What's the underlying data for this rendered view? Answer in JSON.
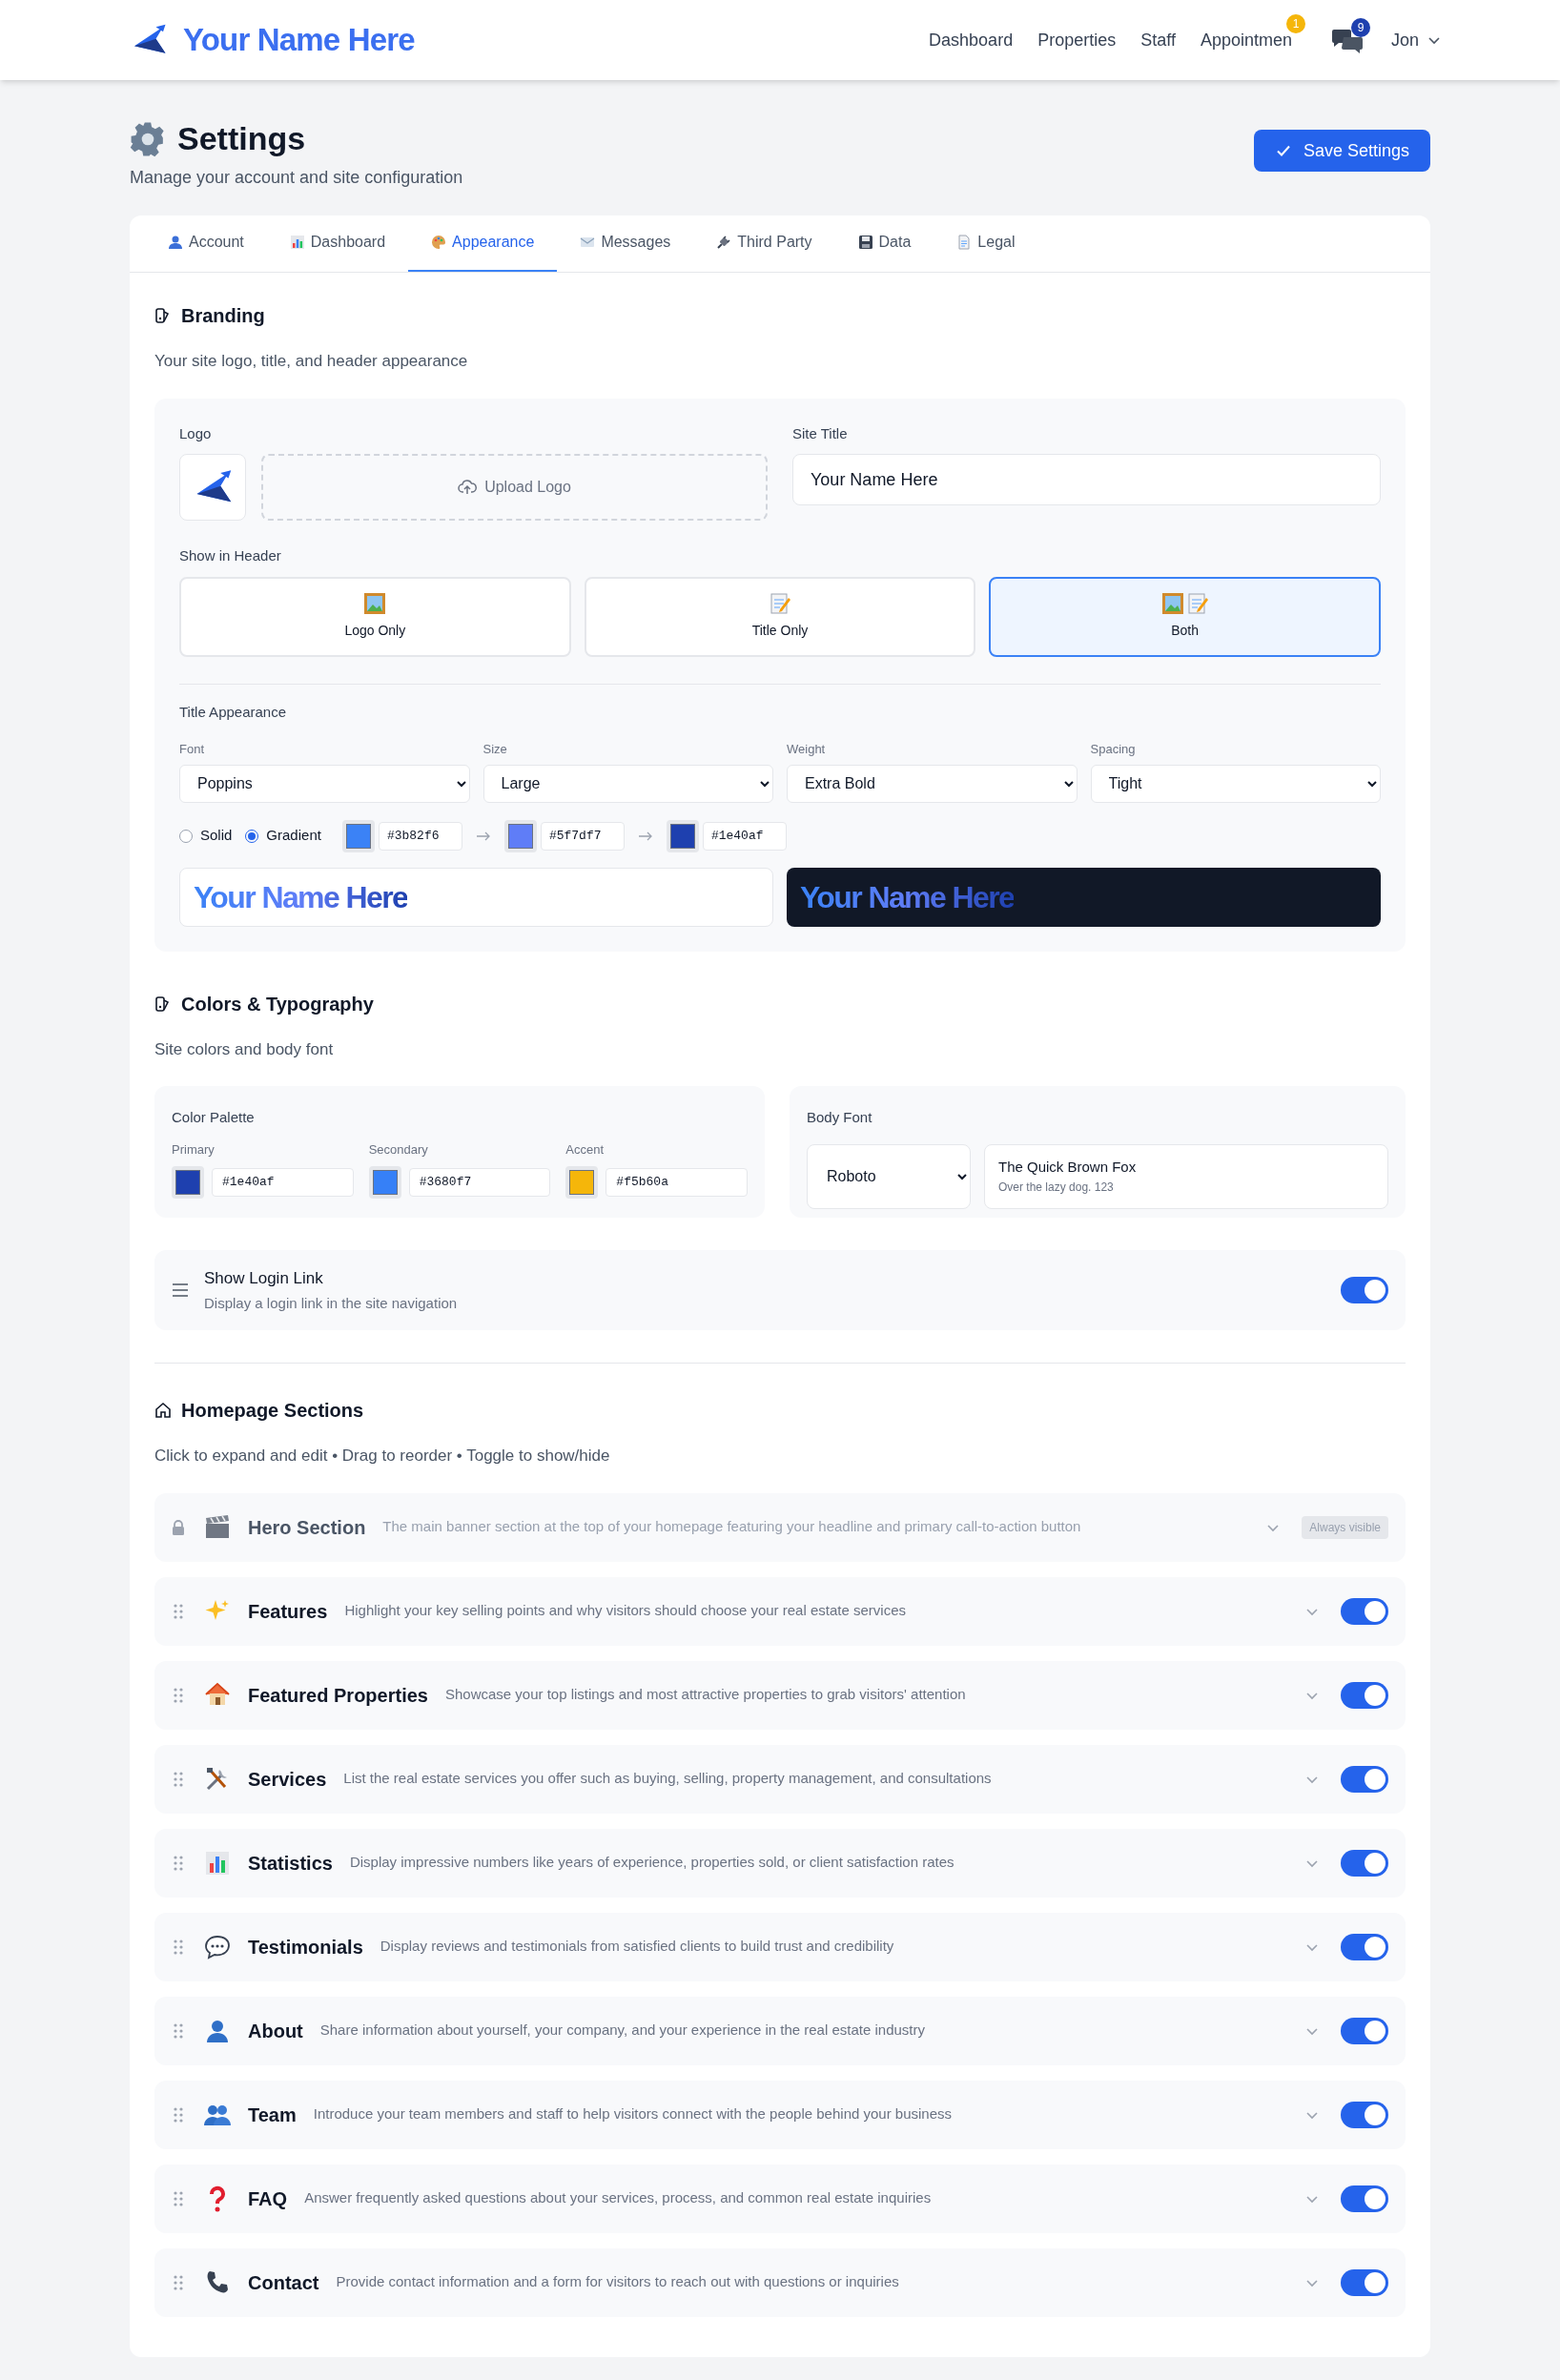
{
  "header": {
    "brand": "Your Name Here",
    "nav": [
      {
        "label": "Dashboard"
      },
      {
        "label": "Properties"
      },
      {
        "label": "Staff"
      },
      {
        "label": "Appointmen",
        "badge": "1"
      }
    ],
    "messages_badge": "9",
    "user": "Jon"
  },
  "page": {
    "title": "Settings",
    "subtitle": "Manage your account and site configuration",
    "save": "Save Settings"
  },
  "tabs": [
    {
      "label": "Account",
      "selected": false
    },
    {
      "label": "Dashboard",
      "selected": false
    },
    {
      "label": "Appearance",
      "selected": true
    },
    {
      "label": "Messages",
      "selected": false
    },
    {
      "label": "Third Party",
      "selected": false
    },
    {
      "label": "Data",
      "selected": false
    },
    {
      "label": "Legal",
      "selected": false
    }
  ],
  "branding": {
    "title": "Branding",
    "description": "Your site logo, title, and header appearance",
    "logo_label": "Logo",
    "upload": "Upload Logo",
    "site_title_label": "Site Title",
    "site_title": "Your Name Here",
    "show_in_header_label": "Show in Header",
    "show_in_header": [
      {
        "label": "Logo Only",
        "selected": false
      },
      {
        "label": "Title Only",
        "selected": false
      },
      {
        "label": "Both",
        "selected": true
      }
    ],
    "title_appearance_label": "Title Appearance",
    "selects": [
      {
        "label": "Font",
        "value": "Poppins"
      },
      {
        "label": "Size",
        "value": "Large"
      },
      {
        "label": "Weight",
        "value": "Extra Bold"
      },
      {
        "label": "Spacing",
        "value": "Tight"
      }
    ],
    "color_mode": [
      {
        "label": "Solid",
        "selected": false
      },
      {
        "label": "Gradient",
        "selected": true
      }
    ],
    "gradient": [
      {
        "color": "#3b82f6",
        "hex": "#3b82f6"
      },
      {
        "color": "#5f7df7",
        "hex": "#5f7df7"
      },
      {
        "color": "#1e40af",
        "hex": "#1e40af"
      }
    ],
    "preview_light": "Your Name Here",
    "preview_dark": "Your Name Here"
  },
  "colors": {
    "title": "Colors & Typography",
    "description": "Site colors and body font",
    "palette_label": "Color Palette",
    "palette": [
      {
        "label": "Primary",
        "color": "#1e40af",
        "hex": "#1e40af"
      },
      {
        "label": "Secondary",
        "color": "#3680f7",
        "hex": "#3680f7"
      },
      {
        "label": "Accent",
        "color": "#f5b60a",
        "hex": "#f5b60a"
      }
    ],
    "body_font_label": "Body Font",
    "body_font": "Roboto",
    "sample_title": "The Quick Brown Fox",
    "sample_text": "Over the lazy dog. 123"
  },
  "login_link": {
    "title": "Show Login Link",
    "description": "Display a login link in the site navigation",
    "on": true
  },
  "homepage": {
    "title": "Homepage Sections",
    "description": "Click to expand and edit • Drag to reorder • Toggle to show/hide",
    "sections": [
      {
        "kind": "locked",
        "title": "Hero Section",
        "description": "The main banner section at the top of your homepage featuring your headline and primary call-to-action button",
        "badge": "Always visible"
      },
      {
        "kind": "toggle",
        "title": "Features",
        "description": "Highlight your key selling points and why visitors should choose your real estate services",
        "on": true
      },
      {
        "kind": "toggle",
        "title": "Featured Properties",
        "description": "Showcase your top listings and most attractive properties to grab visitors' attention",
        "on": true
      },
      {
        "kind": "toggle",
        "title": "Services",
        "description": "List the real estate services you offer such as buying, selling, property management, and consultations",
        "on": true
      },
      {
        "kind": "toggle",
        "title": "Statistics",
        "description": "Display impressive numbers like years of experience, properties sold, or client satisfaction rates",
        "on": true
      },
      {
        "kind": "toggle",
        "title": "Testimonials",
        "description": "Display reviews and testimonials from satisfied clients to build trust and credibility",
        "on": true
      },
      {
        "kind": "toggle",
        "title": "About",
        "description": "Share information about yourself, your company, and your experience in the real estate industry",
        "on": true
      },
      {
        "kind": "toggle",
        "title": "Team",
        "description": "Introduce your team members and staff to help visitors connect with the people behind your business",
        "on": true
      },
      {
        "kind": "toggle",
        "title": "FAQ",
        "description": "Answer frequently asked questions about your services, process, and common real estate inquiries",
        "on": true
      },
      {
        "kind": "toggle",
        "title": "Contact",
        "description": "Provide contact information and a form for visitors to reach out with questions or inquiries",
        "on": true
      }
    ]
  }
}
